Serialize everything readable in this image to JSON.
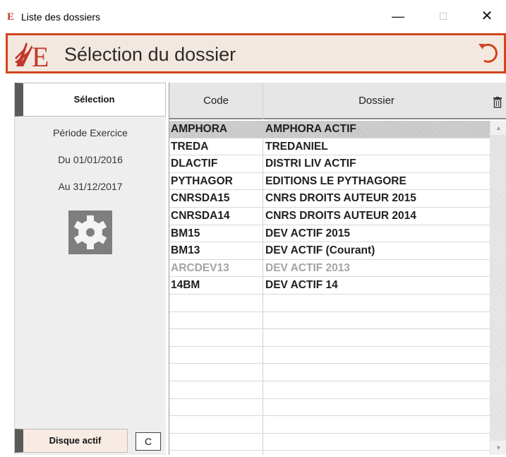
{
  "window": {
    "title": "Liste des dossiers",
    "app_icon_glyph": "E",
    "minimize_glyph": "—",
    "maximize_glyph": "☐",
    "close_glyph": "✕"
  },
  "header": {
    "title": "Sélection du dossier",
    "accent_color": "#d2451e"
  },
  "left_panel": {
    "selection_button": "Sélection",
    "period_label": "Période Exercice",
    "date_from": "Du 01/01/2016",
    "date_to": "Au 31/12/2017",
    "gear_icon": "gear-icon",
    "disk_button": "Disque actif",
    "disk_letter": "C"
  },
  "grid": {
    "columns": {
      "code": "Code",
      "dossier": "Dossier"
    },
    "rows": [
      {
        "code": "AMPHORA",
        "dossier": "AMPHORA ACTIF",
        "state": "selected"
      },
      {
        "code": "TREDA",
        "dossier": "TREDANIEL",
        "state": "normal"
      },
      {
        "code": "DLACTIF",
        "dossier": "DISTRI LIV ACTIF",
        "state": "normal"
      },
      {
        "code": "PYTHAGOR",
        "dossier": "EDITIONS LE PYTHAGORE",
        "state": "normal"
      },
      {
        "code": "CNRSDA15",
        "dossier": "CNRS DROITS AUTEUR 2015",
        "state": "normal"
      },
      {
        "code": "CNRSDA14",
        "dossier": "CNRS DROITS AUTEUR 2014",
        "state": "normal"
      },
      {
        "code": "BM15",
        "dossier": "DEV ACTIF 2015",
        "state": "normal"
      },
      {
        "code": "BM13",
        "dossier": "DEV ACTIF (Courant)",
        "state": "normal"
      },
      {
        "code": "ARCDEV13",
        "dossier": "DEV ACTIF 2013",
        "state": "archived"
      },
      {
        "code": "14BM",
        "dossier": "DEV ACTIF 14",
        "state": "normal"
      }
    ],
    "empty_rows": 9
  }
}
